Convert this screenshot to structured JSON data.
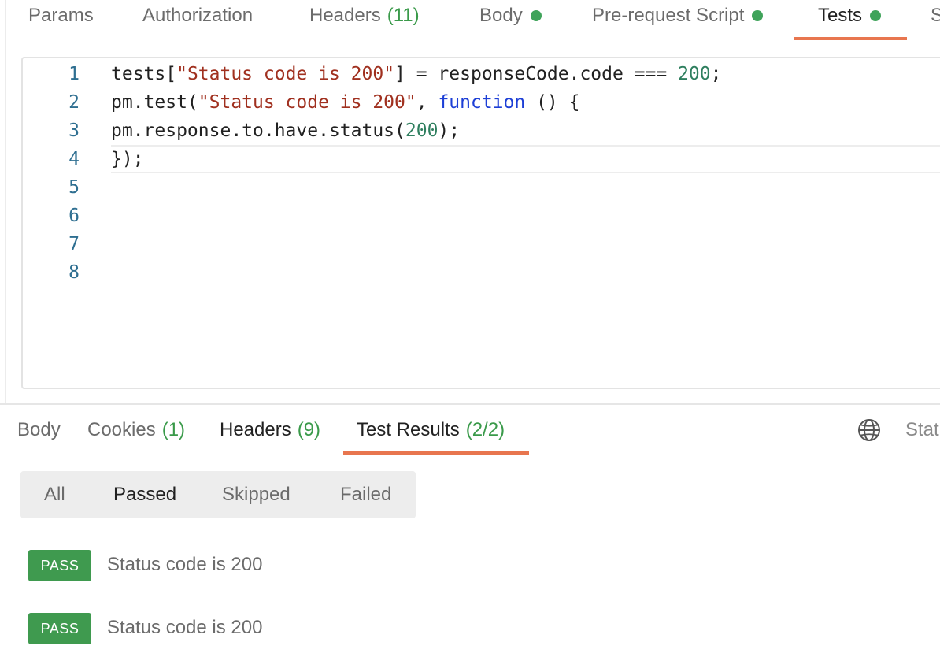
{
  "request_tabs": [
    {
      "label": "Params"
    },
    {
      "label": "Authorization"
    },
    {
      "label": "Headers",
      "count": "(11)"
    },
    {
      "label": "Body",
      "dot": true
    },
    {
      "label": "Pre-request Script",
      "dot": true
    },
    {
      "label": "Tests",
      "dot": true,
      "active": true
    },
    {
      "label": "S"
    }
  ],
  "editor": {
    "lines": [
      {
        "n": "1"
      },
      {
        "n": "2"
      },
      {
        "n": "3"
      },
      {
        "n": "4"
      },
      {
        "n": "5"
      },
      {
        "n": "6"
      },
      {
        "n": "7"
      },
      {
        "n": "8"
      }
    ],
    "code": {
      "l1_a": "tests[",
      "l1_str": "\"Status code is 200\"",
      "l1_b": "] = responseCode.code === ",
      "l1_num": "200",
      "l1_c": ";",
      "l2_a": "pm.test(",
      "l2_str": "\"Status code is 200\"",
      "l2_b": ", ",
      "l2_kw": "function",
      "l2_c": " () {",
      "l3_a": "pm.response.to.have.status(",
      "l3_num": "200",
      "l3_b": ");",
      "l4_a": "});"
    }
  },
  "response_tabs": [
    {
      "label": "Body"
    },
    {
      "label": "Cookies",
      "count": "(1)"
    },
    {
      "label": "Headers",
      "count": "(9)"
    },
    {
      "label": "Test Results",
      "count": "(2/2)",
      "active": true
    }
  ],
  "status_truncated": "Statu",
  "filters": [
    {
      "label": "All"
    },
    {
      "label": "Passed",
      "active": true
    },
    {
      "label": "Skipped"
    },
    {
      "label": "Failed"
    }
  ],
  "results": [
    {
      "badge": "PASS",
      "name": "Status code is 200"
    },
    {
      "badge": "PASS",
      "name": "Status code is 200"
    }
  ],
  "colors": {
    "accent": "#e8764f",
    "pass_green": "#3f9a4f",
    "count_green": "#3a9a4a"
  },
  "icons": {
    "globe": "globe-icon"
  }
}
